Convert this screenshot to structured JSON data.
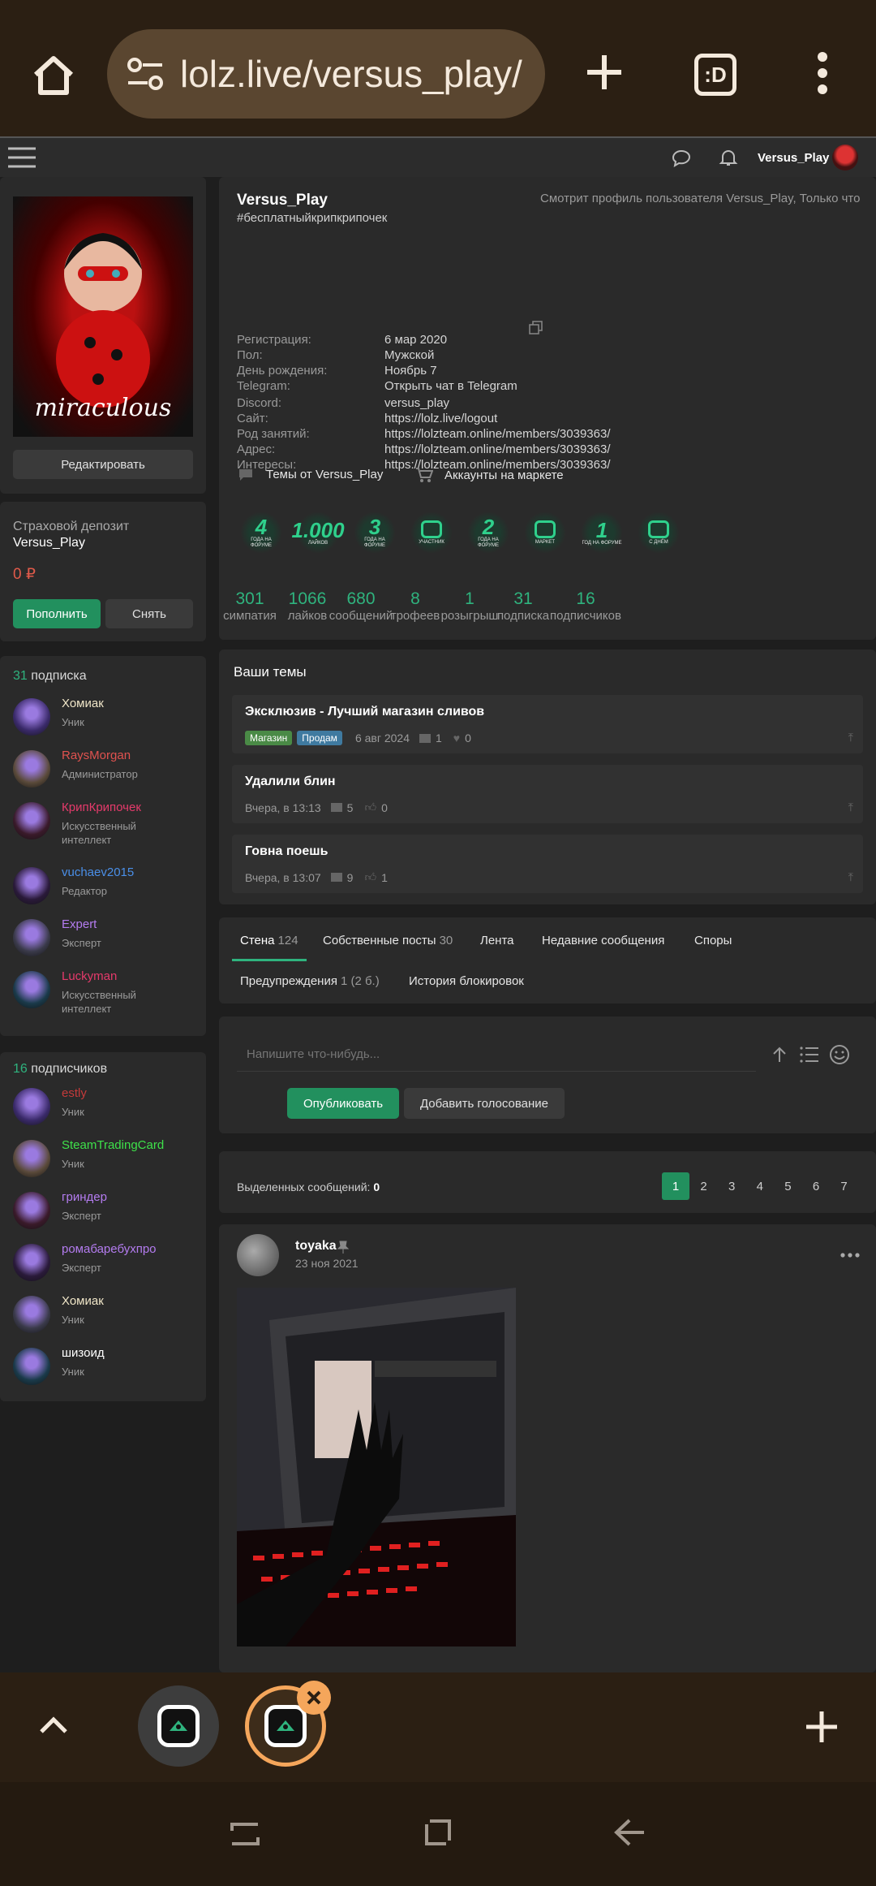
{
  "browser": {
    "url": "lolz.live/versus_play/",
    "tab_count": ":D"
  },
  "topbar": {
    "username": "Versus_Play"
  },
  "profile": {
    "name": "Versus_Play",
    "status": "#бесплатныйкрипкрипочек",
    "viewing": "Смотрит профиль пользователя Versus_Play, Только что",
    "edit_label": "Редактировать",
    "fields": [
      {
        "label": "Регистрация:",
        "value": "6 мар 2020"
      },
      {
        "label": "Пол:",
        "value": "Мужской"
      },
      {
        "label": "День рождения:",
        "value": "Ноябрь 7"
      },
      {
        "label": "Telegram:",
        "value": "Открыть чат в Telegram"
      },
      {
        "label": "Discord:",
        "value": "versus_play"
      },
      {
        "label": "Сайт:",
        "value": "https://lolz.live/logout"
      },
      {
        "label": "Род занятий:",
        "value": "https://lolzteam.online/members/3039363/"
      },
      {
        "label": "Адрес:",
        "value": "https://lolzteam.online/members/3039363/"
      },
      {
        "label": "Интересы:",
        "value": "https://lolzteam.online/members/3039363/"
      }
    ],
    "links": {
      "topics": "Темы от Versus_Play",
      "market": "Аккаунты на маркете"
    },
    "badges": [
      {
        "main": "4",
        "text": "ГОДА НА ФОРУМЕ"
      },
      {
        "main": "1.000",
        "text": "ЛАЙКОВ"
      },
      {
        "main": "3",
        "text": "ГОДА НА ФОРУМЕ"
      },
      {
        "main": "",
        "text": "УЧАСТНИК"
      },
      {
        "main": "2",
        "text": "ГОДА НА ФОРУМЕ"
      },
      {
        "main": "",
        "text": "МАРКЕТ"
      },
      {
        "main": "1",
        "text": "ГОД НА ФОРУМЕ"
      },
      {
        "main": "",
        "text": "С ДНЁМ"
      }
    ],
    "stats": [
      {
        "n": "301",
        "l": "симпатия"
      },
      {
        "n": "1066",
        "l": "лайков"
      },
      {
        "n": "680",
        "l": "сообщений"
      },
      {
        "n": "8",
        "l": "трофеев"
      },
      {
        "n": "1",
        "l": "розыгрыш"
      },
      {
        "n": "31",
        "l": "подписка"
      },
      {
        "n": "16",
        "l": "подписчиков"
      }
    ]
  },
  "deposit": {
    "title": "Страховой депозит",
    "name": "Versus_Play",
    "amount": "0 ₽",
    "topup": "Пополнить",
    "withdraw": "Снять"
  },
  "subscriptions": {
    "count": "31",
    "title": "подписка",
    "items": [
      {
        "name": "Хомиак",
        "role": "Уник",
        "color": "#f0e6c8"
      },
      {
        "name": "RaysMorgan",
        "role": "Администратор",
        "color": "#e0524f"
      },
      {
        "name": "КрипКрипочек",
        "role": "Искусственный интеллект",
        "color": "#e53a6b"
      },
      {
        "name": "vuchaev2015",
        "role": "Редактор",
        "color": "#4a8fe8"
      },
      {
        "name": "Expert",
        "role": "Эксперт",
        "color": "#b47cf0"
      },
      {
        "name": "Luckyman",
        "role": "Искусственный интеллект",
        "color": "#e53a6b"
      }
    ]
  },
  "followers": {
    "count": "16",
    "title": "подписчиков",
    "items": [
      {
        "name": "estly",
        "role": "Уник",
        "color": "#c43a3a"
      },
      {
        "name": "SteamTradingCard",
        "role": "Уник",
        "color": "#3ee14a"
      },
      {
        "name": "гриндер",
        "role": "Эксперт",
        "color": "#b47cf0"
      },
      {
        "name": "ромабаребухпро",
        "role": "Эксперт",
        "color": "#b47cf0"
      },
      {
        "name": "Хомиак",
        "role": "Уник",
        "color": "#f0e6c8"
      },
      {
        "name": "шизоид",
        "role": "Уник",
        "color": "#ffffff"
      }
    ]
  },
  "topics": {
    "title": "Ваши темы",
    "items": [
      {
        "title": "Эксклюзив - Лучший магазин сливов",
        "tags": [
          "Магазин",
          "Продам"
        ],
        "date": "6 авг 2024",
        "replies": "1",
        "likes": "0"
      },
      {
        "title": "Удалили блин",
        "tags": [],
        "date": "Вчера, в 13:13",
        "replies": "5",
        "likes": "0"
      },
      {
        "title": "Говна поешь",
        "tags": [],
        "date": "Вчера, в 13:07",
        "replies": "9",
        "likes": "1"
      }
    ]
  },
  "tabs": [
    {
      "label": "Стена",
      "count": "124"
    },
    {
      "label": "Собственные посты",
      "count": "30"
    },
    {
      "label": "Лента",
      "count": ""
    },
    {
      "label": "Недавние сообщения",
      "count": ""
    },
    {
      "label": "Споры",
      "count": ""
    },
    {
      "label": "Предупреждения",
      "count": "1 (2 б.)"
    },
    {
      "label": "История блокировок",
      "count": ""
    }
  ],
  "composer": {
    "placeholder": "Напишите что-нибудь...",
    "publish": "Опубликовать",
    "poll": "Добавить голосование"
  },
  "pagination": {
    "selected_label": "Выделенных сообщений:",
    "selected_count": "0",
    "pages": [
      "1",
      "2",
      "3",
      "4",
      "5",
      "6",
      "7"
    ],
    "current": "1"
  },
  "post": {
    "author": "toyaka",
    "date": "23 ноя 2021"
  },
  "colors": {
    "accent": "#22905e",
    "browser": "#2b1f13",
    "url_pill": "#5a4630",
    "tab_ring": "#f5a65b"
  }
}
